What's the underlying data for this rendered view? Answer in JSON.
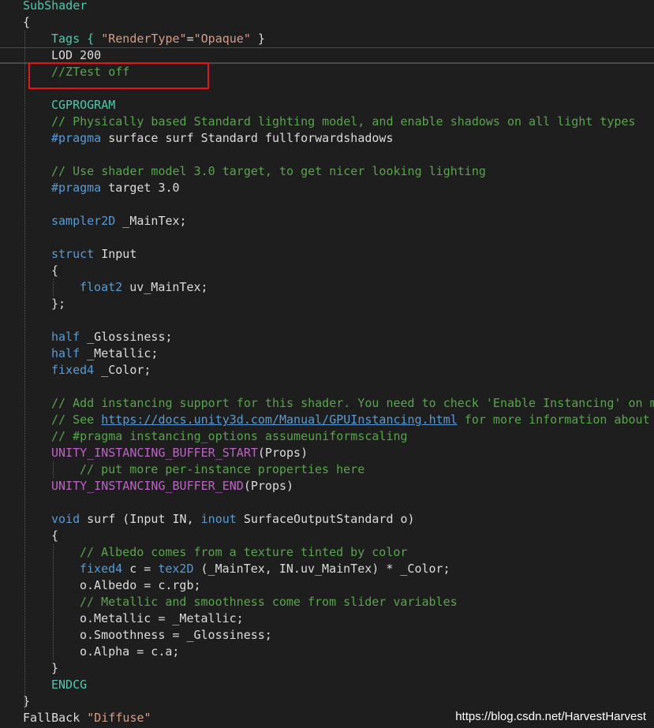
{
  "code_lines": [
    [
      {
        "t": "SubShader",
        "c": "t-type"
      }
    ],
    [
      {
        "t": "{",
        "c": "t-plain"
      }
    ],
    [
      {
        "t": "Tags { ",
        "c": "t-type"
      },
      {
        "t": "\"RenderType\"",
        "c": "t-string"
      },
      {
        "t": "=",
        "c": "t-plain"
      },
      {
        "t": "\"Opaque\"",
        "c": "t-string"
      },
      {
        "t": " }",
        "c": "t-plain"
      }
    ],
    [
      {
        "t": "LOD 200",
        "c": "t-plain"
      }
    ],
    [
      {
        "t": "//ZTest off",
        "c": "t-comment"
      }
    ],
    [],
    [
      {
        "t": "CGPROGRAM",
        "c": "t-type"
      }
    ],
    [
      {
        "t": "// Physically based Standard lighting model, and enable shadows on all light types",
        "c": "t-comment"
      }
    ],
    [
      {
        "t": "#pragma",
        "c": "t-kw"
      },
      {
        "t": " surface surf Standard fullforwardshadows",
        "c": "t-plain"
      }
    ],
    [],
    [
      {
        "t": "// Use shader model 3.0 target, to get nicer looking lighting",
        "c": "t-comment"
      }
    ],
    [
      {
        "t": "#pragma",
        "c": "t-kw"
      },
      {
        "t": " target 3.0",
        "c": "t-plain"
      }
    ],
    [],
    [
      {
        "t": "sampler2D",
        "c": "t-kw"
      },
      {
        "t": " _MainTex;",
        "c": "t-plain"
      }
    ],
    [],
    [
      {
        "t": "struct",
        "c": "t-kw"
      },
      {
        "t": " Input",
        "c": "t-plain"
      }
    ],
    [
      {
        "t": "{",
        "c": "t-plain"
      }
    ],
    [
      {
        "t": "float2",
        "c": "t-kw"
      },
      {
        "t": " uv_MainTex;",
        "c": "t-plain"
      }
    ],
    [
      {
        "t": "};",
        "c": "t-plain"
      }
    ],
    [],
    [
      {
        "t": "half",
        "c": "t-kw"
      },
      {
        "t": " _Glossiness;",
        "c": "t-plain"
      }
    ],
    [
      {
        "t": "half",
        "c": "t-kw"
      },
      {
        "t": " _Metallic;",
        "c": "t-plain"
      }
    ],
    [
      {
        "t": "fixed4",
        "c": "t-kw"
      },
      {
        "t": " _Color;",
        "c": "t-plain"
      }
    ],
    [],
    [
      {
        "t": "// Add instancing support for this shader. You need to check 'Enable Instancing' on m",
        "c": "t-comment"
      }
    ],
    [
      {
        "t": "// See ",
        "c": "t-comment"
      },
      {
        "t": "https://docs.unity3d.com/Manual/GPUInstancing.html",
        "c": "t-link"
      },
      {
        "t": " for more information about",
        "c": "t-comment"
      }
    ],
    [
      {
        "t": "// #pragma instancing_options assumeuniformscaling",
        "c": "t-comment"
      }
    ],
    [
      {
        "t": "UNITY_INSTANCING_BUFFER_START",
        "c": "t-macro"
      },
      {
        "t": "(Props)",
        "c": "t-plain"
      }
    ],
    [
      {
        "t": "// put more per-instance properties here",
        "c": "t-comment"
      }
    ],
    [
      {
        "t": "UNITY_INSTANCING_BUFFER_END",
        "c": "t-macro"
      },
      {
        "t": "(Props)",
        "c": "t-plain"
      }
    ],
    [],
    [
      {
        "t": "void",
        "c": "t-kw"
      },
      {
        "t": " surf (Input IN, ",
        "c": "t-plain"
      },
      {
        "t": "inout",
        "c": "t-kw"
      },
      {
        "t": " SurfaceOutputStandard o)",
        "c": "t-plain"
      }
    ],
    [
      {
        "t": "{",
        "c": "t-plain"
      }
    ],
    [
      {
        "t": "// Albedo comes from a texture tinted by color",
        "c": "t-comment"
      }
    ],
    [
      {
        "t": "fixed4",
        "c": "t-kw"
      },
      {
        "t": " c = ",
        "c": "t-plain"
      },
      {
        "t": "tex2D",
        "c": "t-kw"
      },
      {
        "t": " (_MainTex, IN.uv_MainTex) * _Color;",
        "c": "t-plain"
      }
    ],
    [
      {
        "t": "o.Albedo = c.rgb;",
        "c": "t-plain"
      }
    ],
    [
      {
        "t": "// Metallic and smoothness come from slider variables",
        "c": "t-comment"
      }
    ],
    [
      {
        "t": "o.Metallic = _Metallic;",
        "c": "t-plain"
      }
    ],
    [
      {
        "t": "o.Smoothness = _Glossiness;",
        "c": "t-plain"
      }
    ],
    [
      {
        "t": "o.Alpha = c.a;",
        "c": "t-plain"
      }
    ],
    [
      {
        "t": "}",
        "c": "t-plain"
      }
    ],
    [
      {
        "t": "ENDCG",
        "c": "t-type"
      }
    ],
    [
      {
        "t": "}",
        "c": "t-plain"
      }
    ],
    [
      {
        "t": "FallBack ",
        "c": "t-plain"
      },
      {
        "t": "\"Diffuse\"",
        "c": "t-string"
      }
    ]
  ],
  "watermark": "https://blog.csdn.net/HarvestHarvest",
  "colors": {
    "background": "#1e1e1e",
    "keyword": "#569cd6",
    "type": "#4ec9b0",
    "comment": "#57a64a",
    "string": "#d69d85",
    "macro": "#bd63c5",
    "highlight_box": "#e0161c"
  }
}
